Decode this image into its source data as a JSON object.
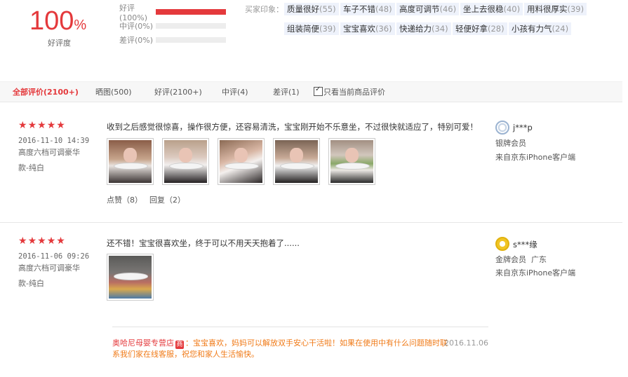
{
  "summary": {
    "rate_value": "100",
    "rate_unit": "%",
    "rate_label": "好评度",
    "bars": [
      {
        "label": "好评(100%)",
        "fraction": 1.0
      },
      {
        "label": "中评(0%)",
        "fraction": 0.0
      },
      {
        "label": "差评(0%)",
        "fraction": 0.0
      }
    ],
    "impression_title": "买家印象：",
    "tags_row1": [
      {
        "label": "质量很好",
        "count": "(55)"
      },
      {
        "label": "车子不错",
        "count": "(48)"
      },
      {
        "label": "高度可调节",
        "count": "(46)"
      },
      {
        "label": "坐上去很稳",
        "count": "(40)"
      },
      {
        "label": "用料很厚实",
        "count": "(39)"
      }
    ],
    "tags_row2": [
      {
        "label": "组装简便",
        "count": "(39)"
      },
      {
        "label": "宝宝喜欢",
        "count": "(36)"
      },
      {
        "label": "快递给力",
        "count": "(34)"
      },
      {
        "label": "轻便好拿",
        "count": "(28)"
      },
      {
        "label": "小孩有力气",
        "count": "(24)"
      }
    ]
  },
  "tabs": {
    "all": "全部评价(2100+)",
    "pics": "晒图(500)",
    "good": "好评(2100+)",
    "medium": "中评(4)",
    "bad": "差评(1)",
    "only_current": "只看当前商品评价"
  },
  "colors": {
    "accent": "#e4393c",
    "reply": "#f07b19",
    "tag_bg": "#eef2fb"
  },
  "reviews": [
    {
      "stars": 5,
      "date": "2016-11-10 14:39",
      "spec_line1": "高度六档可调豪华",
      "spec_line2": "款-纯白",
      "content": "收到之后感觉很惊喜，操作很方便，还容易清洗，宝宝刚开始不乐意坐，不过很快就适应了，特别可爱！",
      "photo_count": 5,
      "like_label": "点赞（8）",
      "reply_label": "回复（2）",
      "user": "j***p",
      "level": "银牌会员",
      "location": "",
      "source": "来自京东iPhone客户端",
      "avatar_icon": "silver-member-icon"
    },
    {
      "stars": 5,
      "date": "2016-11-06 09:26",
      "spec_line1": "高度六档可调豪华",
      "spec_line2": "款-纯白",
      "content": "还不错！宝宝很喜欢坐，终于可以不用天天抱着了......",
      "photo_count": 1,
      "user": "s***缘",
      "level": "金牌会员",
      "location": "广东",
      "source": "来自京东iPhone客户端",
      "avatar_icon": "gold-member-icon",
      "seller_reply": {
        "shop": "奥哈尼母婴专营店",
        "badge": "商",
        "text_line1": "：宝宝喜欢，妈妈可以解放双手安心干活啦！如果在使用中有什么问题随时联",
        "text_line2": "系我们家在线客服，祝您和家人生活愉快。",
        "date": "2016.11.06"
      }
    }
  ]
}
